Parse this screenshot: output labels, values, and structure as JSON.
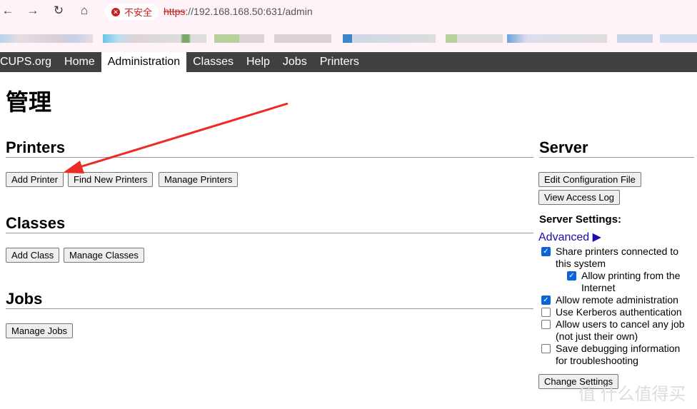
{
  "browser": {
    "security_label": "不安全",
    "url_scheme": "https",
    "url_rest": "://192.168.168.50:631/admin"
  },
  "nav": [
    "CUPS.org",
    "Home",
    "Administration",
    "Classes",
    "Help",
    "Jobs",
    "Printers"
  ],
  "page_title": "管理",
  "printers": {
    "heading": "Printers",
    "buttons": [
      "Add Printer",
      "Find New Printers",
      "Manage Printers"
    ]
  },
  "classes": {
    "heading": "Classes",
    "buttons": [
      "Add Class",
      "Manage Classes"
    ]
  },
  "jobs": {
    "heading": "Jobs",
    "buttons": [
      "Manage Jobs"
    ]
  },
  "server": {
    "heading": "Server",
    "buttons": [
      "Edit Configuration File",
      "View Access Log"
    ],
    "settings_label": "Server Settings:",
    "advanced": "Advanced ▶",
    "options": [
      {
        "label": "Share printers connected to this system",
        "checked": true
      },
      {
        "label": "Allow printing from the Internet",
        "checked": true
      },
      {
        "label": "Allow remote administration",
        "checked": true
      },
      {
        "label": "Use Kerberos authentication",
        "checked": false
      },
      {
        "label": "Allow users to cancel any job (not just their own)",
        "checked": false
      },
      {
        "label": "Save debugging information for troubleshooting",
        "checked": false
      }
    ],
    "change_button": "Change Settings"
  },
  "watermark": "值 什么值得买",
  "colors": {
    "nav_bg": "#404040",
    "link": "#1a0dab",
    "arrow": "#ee2a24",
    "checkbox": "#0b64d8"
  }
}
